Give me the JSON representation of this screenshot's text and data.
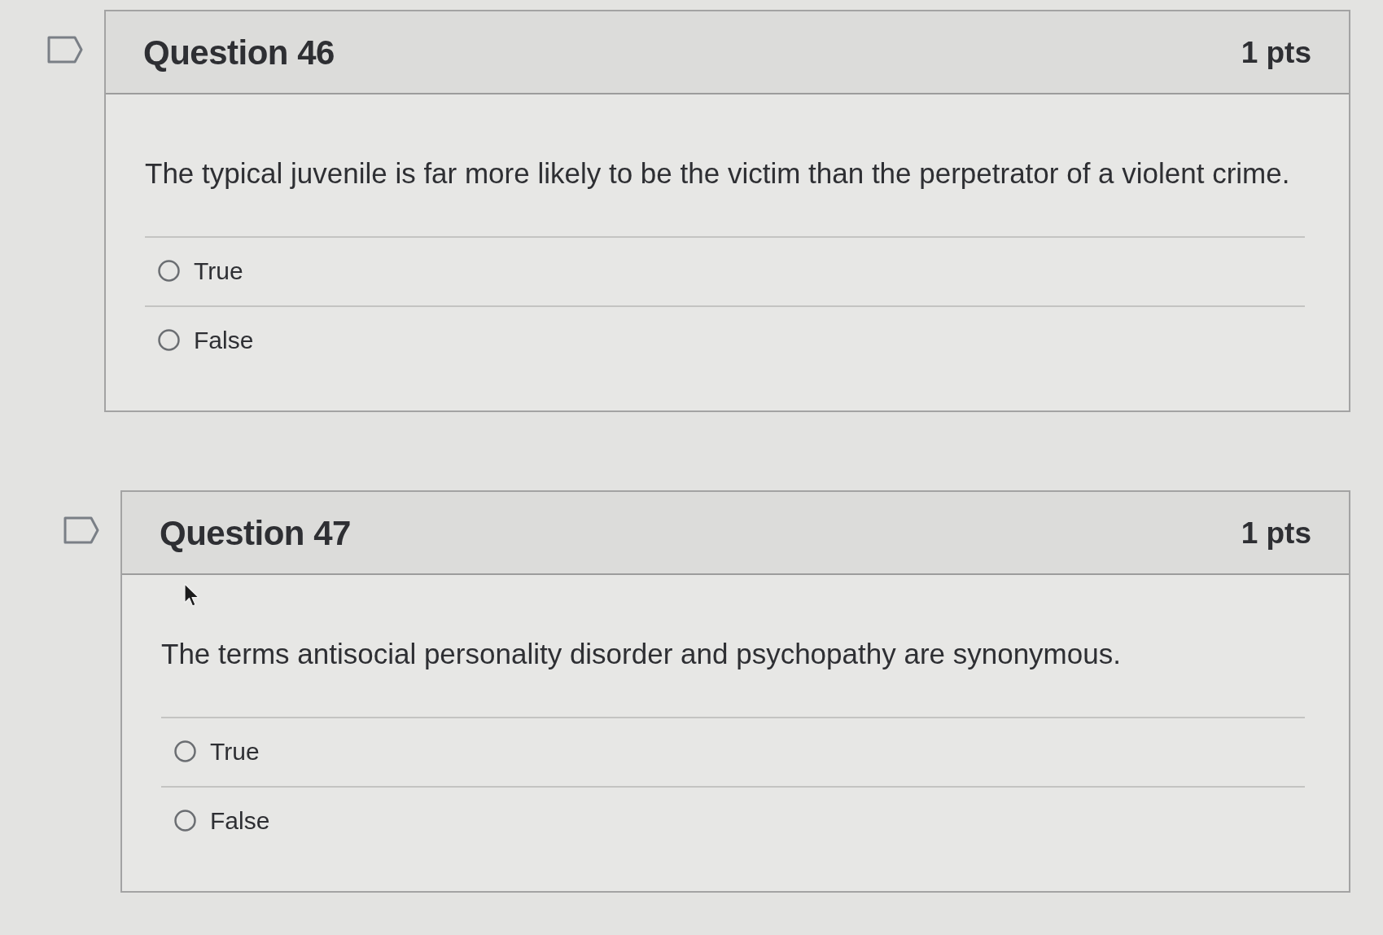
{
  "questions": [
    {
      "title": "Question 46",
      "points": "1 pts",
      "text": "The typical juvenile is far more likely to be the victim than the perpetrator of a violent crime.",
      "answers": [
        {
          "label": "True",
          "selected": false
        },
        {
          "label": "False",
          "selected": false
        }
      ]
    },
    {
      "title": "Question 47",
      "points": "1 pts",
      "text": "The terms antisocial personality disorder and psychopathy are synonymous.",
      "answers": [
        {
          "label": "True",
          "selected": false
        },
        {
          "label": "False",
          "selected": false
        }
      ]
    }
  ]
}
